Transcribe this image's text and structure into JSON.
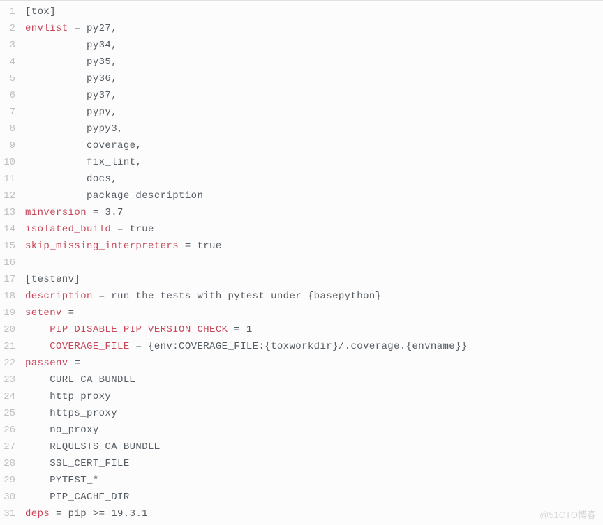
{
  "watermark": "@51CTO博客",
  "lines": [
    {
      "n": 1,
      "segs": [
        {
          "c": "txt",
          "t": "[tox]"
        }
      ]
    },
    {
      "n": 2,
      "segs": [
        {
          "c": "kw",
          "t": "envlist"
        },
        {
          "c": "txt",
          "t": " = py27,"
        }
      ]
    },
    {
      "n": 3,
      "segs": [
        {
          "c": "txt",
          "t": "          py34,"
        }
      ]
    },
    {
      "n": 4,
      "segs": [
        {
          "c": "txt",
          "t": "          py35,"
        }
      ]
    },
    {
      "n": 5,
      "segs": [
        {
          "c": "txt",
          "t": "          py36,"
        }
      ]
    },
    {
      "n": 6,
      "segs": [
        {
          "c": "txt",
          "t": "          py37,"
        }
      ]
    },
    {
      "n": 7,
      "segs": [
        {
          "c": "txt",
          "t": "          pypy,"
        }
      ]
    },
    {
      "n": 8,
      "segs": [
        {
          "c": "txt",
          "t": "          pypy3,"
        }
      ]
    },
    {
      "n": 9,
      "segs": [
        {
          "c": "txt",
          "t": "          coverage,"
        }
      ]
    },
    {
      "n": 10,
      "segs": [
        {
          "c": "txt",
          "t": "          fix_lint,"
        }
      ]
    },
    {
      "n": 11,
      "segs": [
        {
          "c": "txt",
          "t": "          docs,"
        }
      ]
    },
    {
      "n": 12,
      "segs": [
        {
          "c": "txt",
          "t": "          package_description"
        }
      ]
    },
    {
      "n": 13,
      "segs": [
        {
          "c": "kw",
          "t": "minversion"
        },
        {
          "c": "txt",
          "t": " = 3.7"
        }
      ]
    },
    {
      "n": 14,
      "segs": [
        {
          "c": "kw",
          "t": "isolated_build"
        },
        {
          "c": "txt",
          "t": " = true"
        }
      ]
    },
    {
      "n": 15,
      "segs": [
        {
          "c": "kw",
          "t": "skip_missing_interpreters"
        },
        {
          "c": "txt",
          "t": " = true"
        }
      ]
    },
    {
      "n": 16,
      "segs": [
        {
          "c": "txt",
          "t": ""
        }
      ]
    },
    {
      "n": 17,
      "segs": [
        {
          "c": "txt",
          "t": "[testenv]"
        }
      ]
    },
    {
      "n": 18,
      "segs": [
        {
          "c": "kw",
          "t": "description"
        },
        {
          "c": "txt",
          "t": " = run the tests with pytest under {basepython}"
        }
      ]
    },
    {
      "n": 19,
      "segs": [
        {
          "c": "kw",
          "t": "setenv"
        },
        {
          "c": "txt",
          "t": " ="
        }
      ]
    },
    {
      "n": 20,
      "segs": [
        {
          "c": "txt",
          "t": "    "
        },
        {
          "c": "kw",
          "t": "PIP_DISABLE_PIP_VERSION_CHECK"
        },
        {
          "c": "txt",
          "t": " = 1"
        }
      ]
    },
    {
      "n": 21,
      "segs": [
        {
          "c": "txt",
          "t": "    "
        },
        {
          "c": "kw",
          "t": "COVERAGE_FILE"
        },
        {
          "c": "txt",
          "t": " = {env:COVERAGE_FILE:{toxworkdir}/.coverage.{envname}}"
        }
      ]
    },
    {
      "n": 22,
      "segs": [
        {
          "c": "kw",
          "t": "passenv"
        },
        {
          "c": "txt",
          "t": " ="
        }
      ]
    },
    {
      "n": 23,
      "segs": [
        {
          "c": "txt",
          "t": "    CURL_CA_BUNDLE"
        }
      ]
    },
    {
      "n": 24,
      "segs": [
        {
          "c": "txt",
          "t": "    http_proxy"
        }
      ]
    },
    {
      "n": 25,
      "segs": [
        {
          "c": "txt",
          "t": "    https_proxy"
        }
      ]
    },
    {
      "n": 26,
      "segs": [
        {
          "c": "txt",
          "t": "    no_proxy"
        }
      ]
    },
    {
      "n": 27,
      "segs": [
        {
          "c": "txt",
          "t": "    REQUESTS_CA_BUNDLE"
        }
      ]
    },
    {
      "n": 28,
      "segs": [
        {
          "c": "txt",
          "t": "    SSL_CERT_FILE"
        }
      ]
    },
    {
      "n": 29,
      "segs": [
        {
          "c": "txt",
          "t": "    PYTEST_*"
        }
      ]
    },
    {
      "n": 30,
      "segs": [
        {
          "c": "txt",
          "t": "    PIP_CACHE_DIR"
        }
      ]
    },
    {
      "n": 31,
      "segs": [
        {
          "c": "kw",
          "t": "deps"
        },
        {
          "c": "txt",
          "t": " = pip >= 19.3.1"
        }
      ]
    }
  ]
}
